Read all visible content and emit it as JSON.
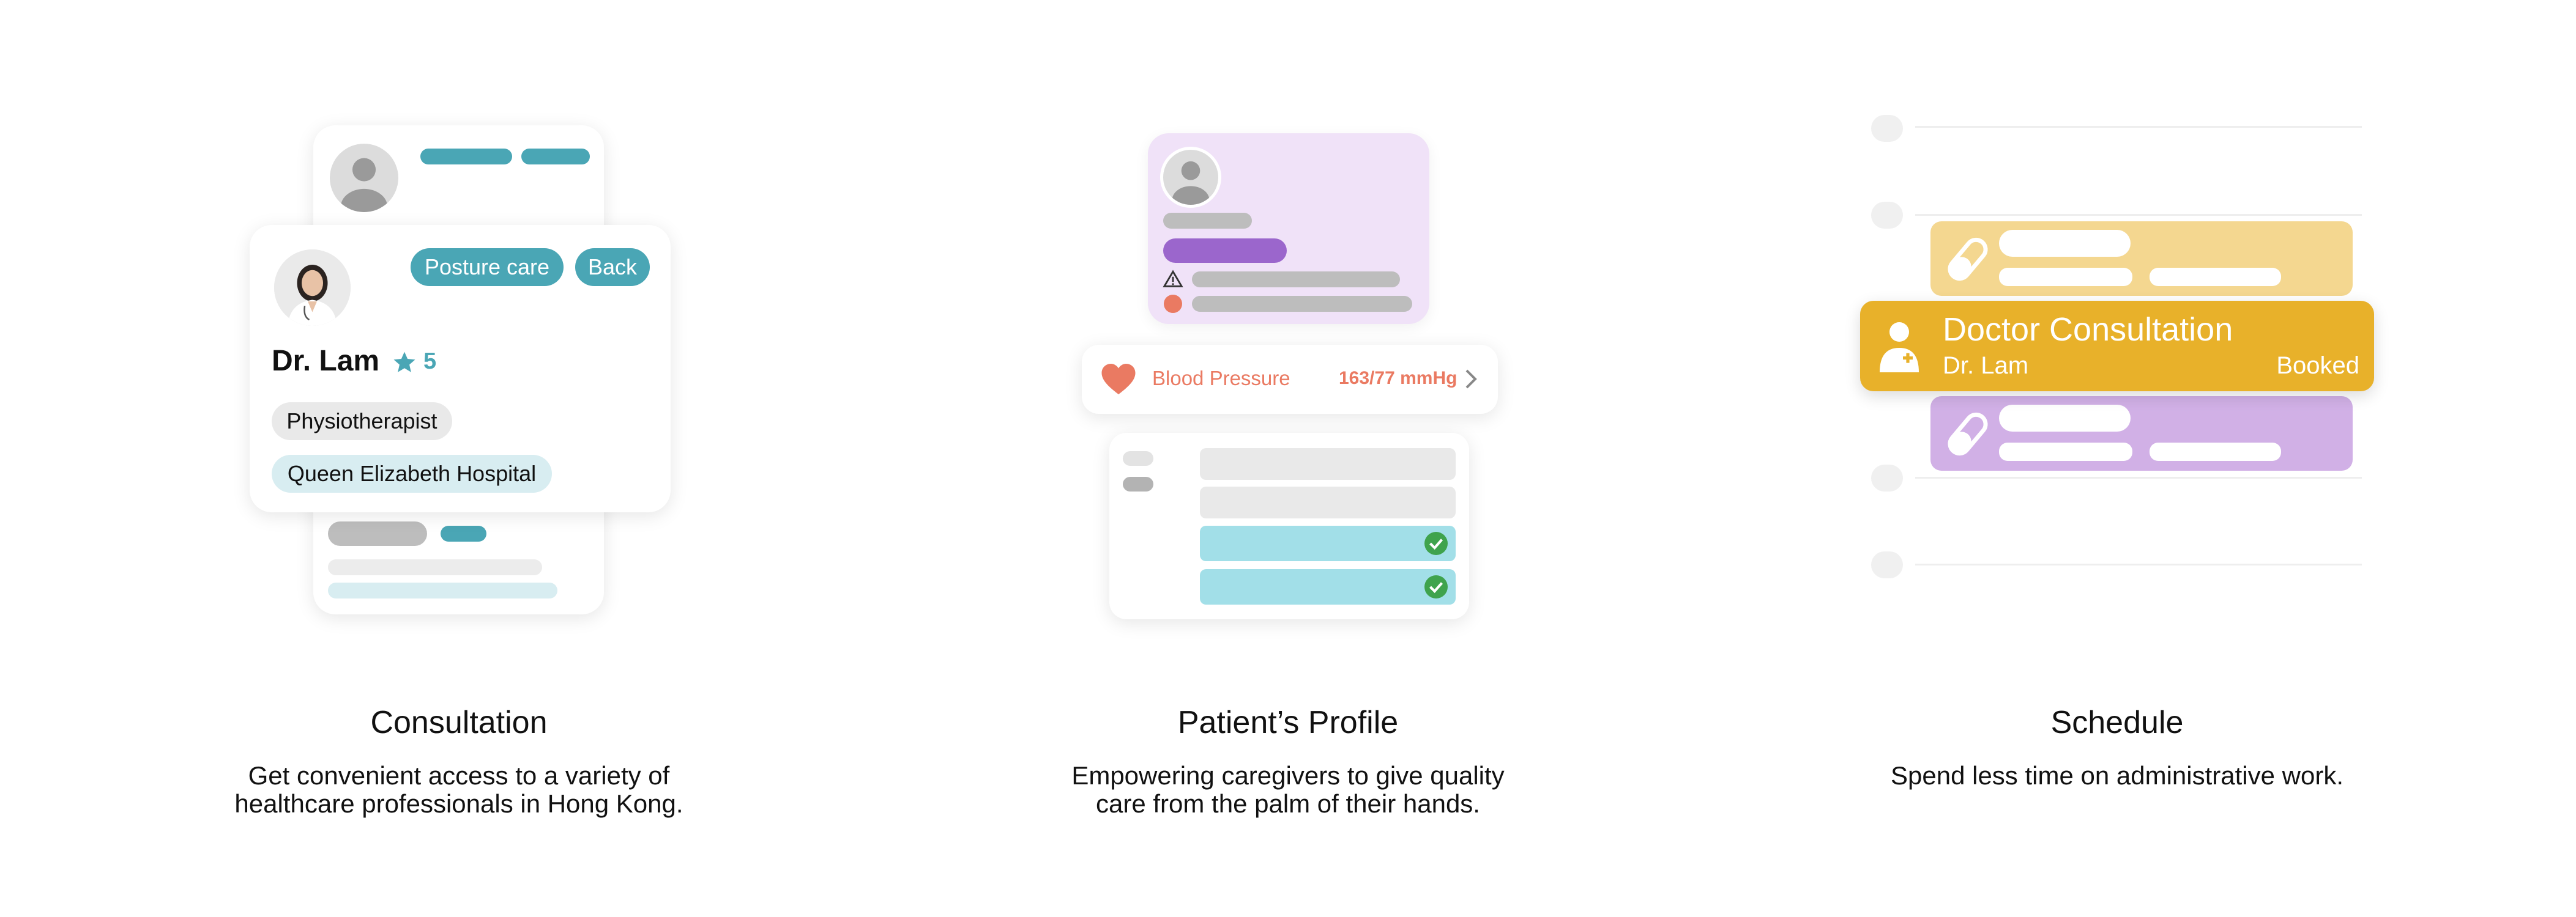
{
  "consultation": {
    "card": {
      "tags": [
        "Posture care",
        "Back"
      ],
      "doctor_name": "Dr. Lam",
      "rating": "5",
      "specialty": "Physiotherapist",
      "hospital": "Queen Elizabeth Hospital"
    },
    "caption_title": "Consultation",
    "caption_desc_line1": "Get convenient access to a variety of",
    "caption_desc_line2": "healthcare professionals in Hong Kong."
  },
  "profile": {
    "vital_label": "Blood Pressure",
    "vital_value": "163/77 mmHg",
    "caption_title": "Patient’s Profile",
    "caption_desc_line1": "Empowering caregivers to give quality",
    "caption_desc_line2": "care from the palm of their hands."
  },
  "schedule": {
    "highlight_title": "Doctor Consultation",
    "highlight_doctor": "Dr. Lam",
    "highlight_status": "Booked",
    "caption_title": "Schedule",
    "caption_desc_line1": "Spend less time on administrative work."
  },
  "colors": {
    "teal": "#4aa6b5",
    "purple": "#9b66cc",
    "lavender": "#f0e2f8",
    "coral": "#ea7a62",
    "amber": "#e8b12a",
    "amber_light": "#f4d790",
    "purple_light": "#d1b0e6",
    "cyan_light": "#a2dfe8"
  }
}
